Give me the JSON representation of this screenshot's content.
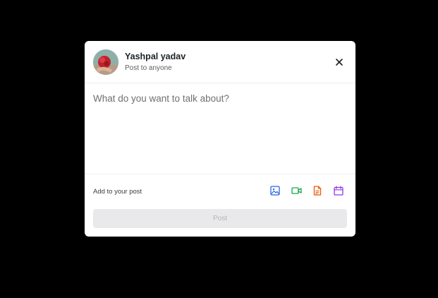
{
  "user": {
    "name": "Yashpal yadav",
    "audience": "Post to anyone"
  },
  "composer": {
    "placeholder": "What do you want to talk about?",
    "value": ""
  },
  "toolbar": {
    "add_label": "Add to your post",
    "icons": [
      {
        "name": "image-icon",
        "color": "#2563eb"
      },
      {
        "name": "video-icon",
        "color": "#16a34a"
      },
      {
        "name": "document-icon",
        "color": "#ea580c"
      },
      {
        "name": "calendar-icon",
        "color": "#9333ea"
      }
    ]
  },
  "post_button": {
    "label": "Post",
    "disabled": true
  },
  "colors": {
    "backdrop": "#000000",
    "modal_bg": "#ffffff",
    "post_button_bg": "#e9e9ec"
  }
}
